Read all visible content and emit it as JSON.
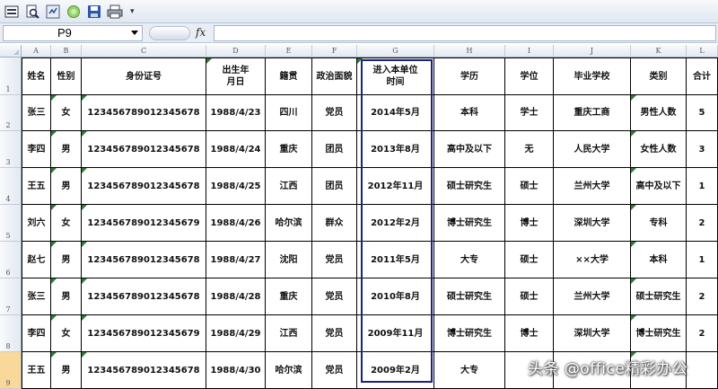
{
  "toolbar": {
    "buttons": [
      "form-icon",
      "print-preview-icon",
      "refresh-icon",
      "record-icon",
      "save-icon",
      "print-icon"
    ],
    "more": "▾"
  },
  "formula_bar": {
    "name_box": "P9",
    "fx": "fx",
    "formula": ""
  },
  "columns": [
    "A",
    "B",
    "C",
    "D",
    "E",
    "F",
    "G",
    "H",
    "I",
    "J",
    "K",
    "L"
  ],
  "rows": [
    "1",
    "2",
    "3",
    "4",
    "5",
    "6",
    "7",
    "8",
    "9"
  ],
  "active_row": "9",
  "table": {
    "headers": [
      "姓名",
      "性别",
      "身份证号",
      "出生年\n月日",
      "籍贯",
      "政治面貌",
      "进入本单位\n时间",
      "学历",
      "学位",
      "毕业学校",
      "类别",
      "合计"
    ],
    "data": [
      [
        "张三",
        "女",
        "123456789012345678",
        "1988/4/23",
        "四川",
        "党员",
        "2014年5月",
        "本科",
        "学士",
        "重庆工商",
        "男性人数",
        "5"
      ],
      [
        "李四",
        "男",
        "123456789012345678",
        "1988/4/24",
        "重庆",
        "团员",
        "2013年8月",
        "高中及以下",
        "无",
        "人民大学",
        "女性人数",
        "3"
      ],
      [
        "王五",
        "男",
        "123456789012345678",
        "1988/4/25",
        "江西",
        "团员",
        "2012年11月",
        "硕士研究生",
        "硕士",
        "兰州大学",
        "高中及以下",
        "1"
      ],
      [
        "刘六",
        "女",
        "123456789012345679",
        "1988/4/26",
        "哈尔滨",
        "群众",
        "2012年2月",
        "博士研究生",
        "博士",
        "深圳大学",
        "专科",
        "2"
      ],
      [
        "赵七",
        "男",
        "123456789012345678",
        "1988/4/27",
        "沈阳",
        "党员",
        "2011年5月",
        "大专",
        "硕士",
        "××大学",
        "本科",
        "1"
      ],
      [
        "张三",
        "男",
        "123456789012345678",
        "1988/4/28",
        "重庆",
        "党员",
        "2010年8月",
        "硕士研究生",
        "硕士",
        "兰州大学",
        "硕士研究生",
        "2"
      ],
      [
        "李四",
        "女",
        "123456789012345679",
        "1988/4/29",
        "江西",
        "党员",
        "2009年11月",
        "博士研究生",
        "博士",
        "深圳大学",
        "博士研究生",
        "2"
      ],
      [
        "王五",
        "男",
        "123456789012345678",
        "1988/4/30",
        "哈尔滨",
        "党员",
        "2009年2月",
        "大专",
        "",
        "",
        "",
        ""
      ]
    ]
  },
  "watermark": "头条 @office精彩办公"
}
